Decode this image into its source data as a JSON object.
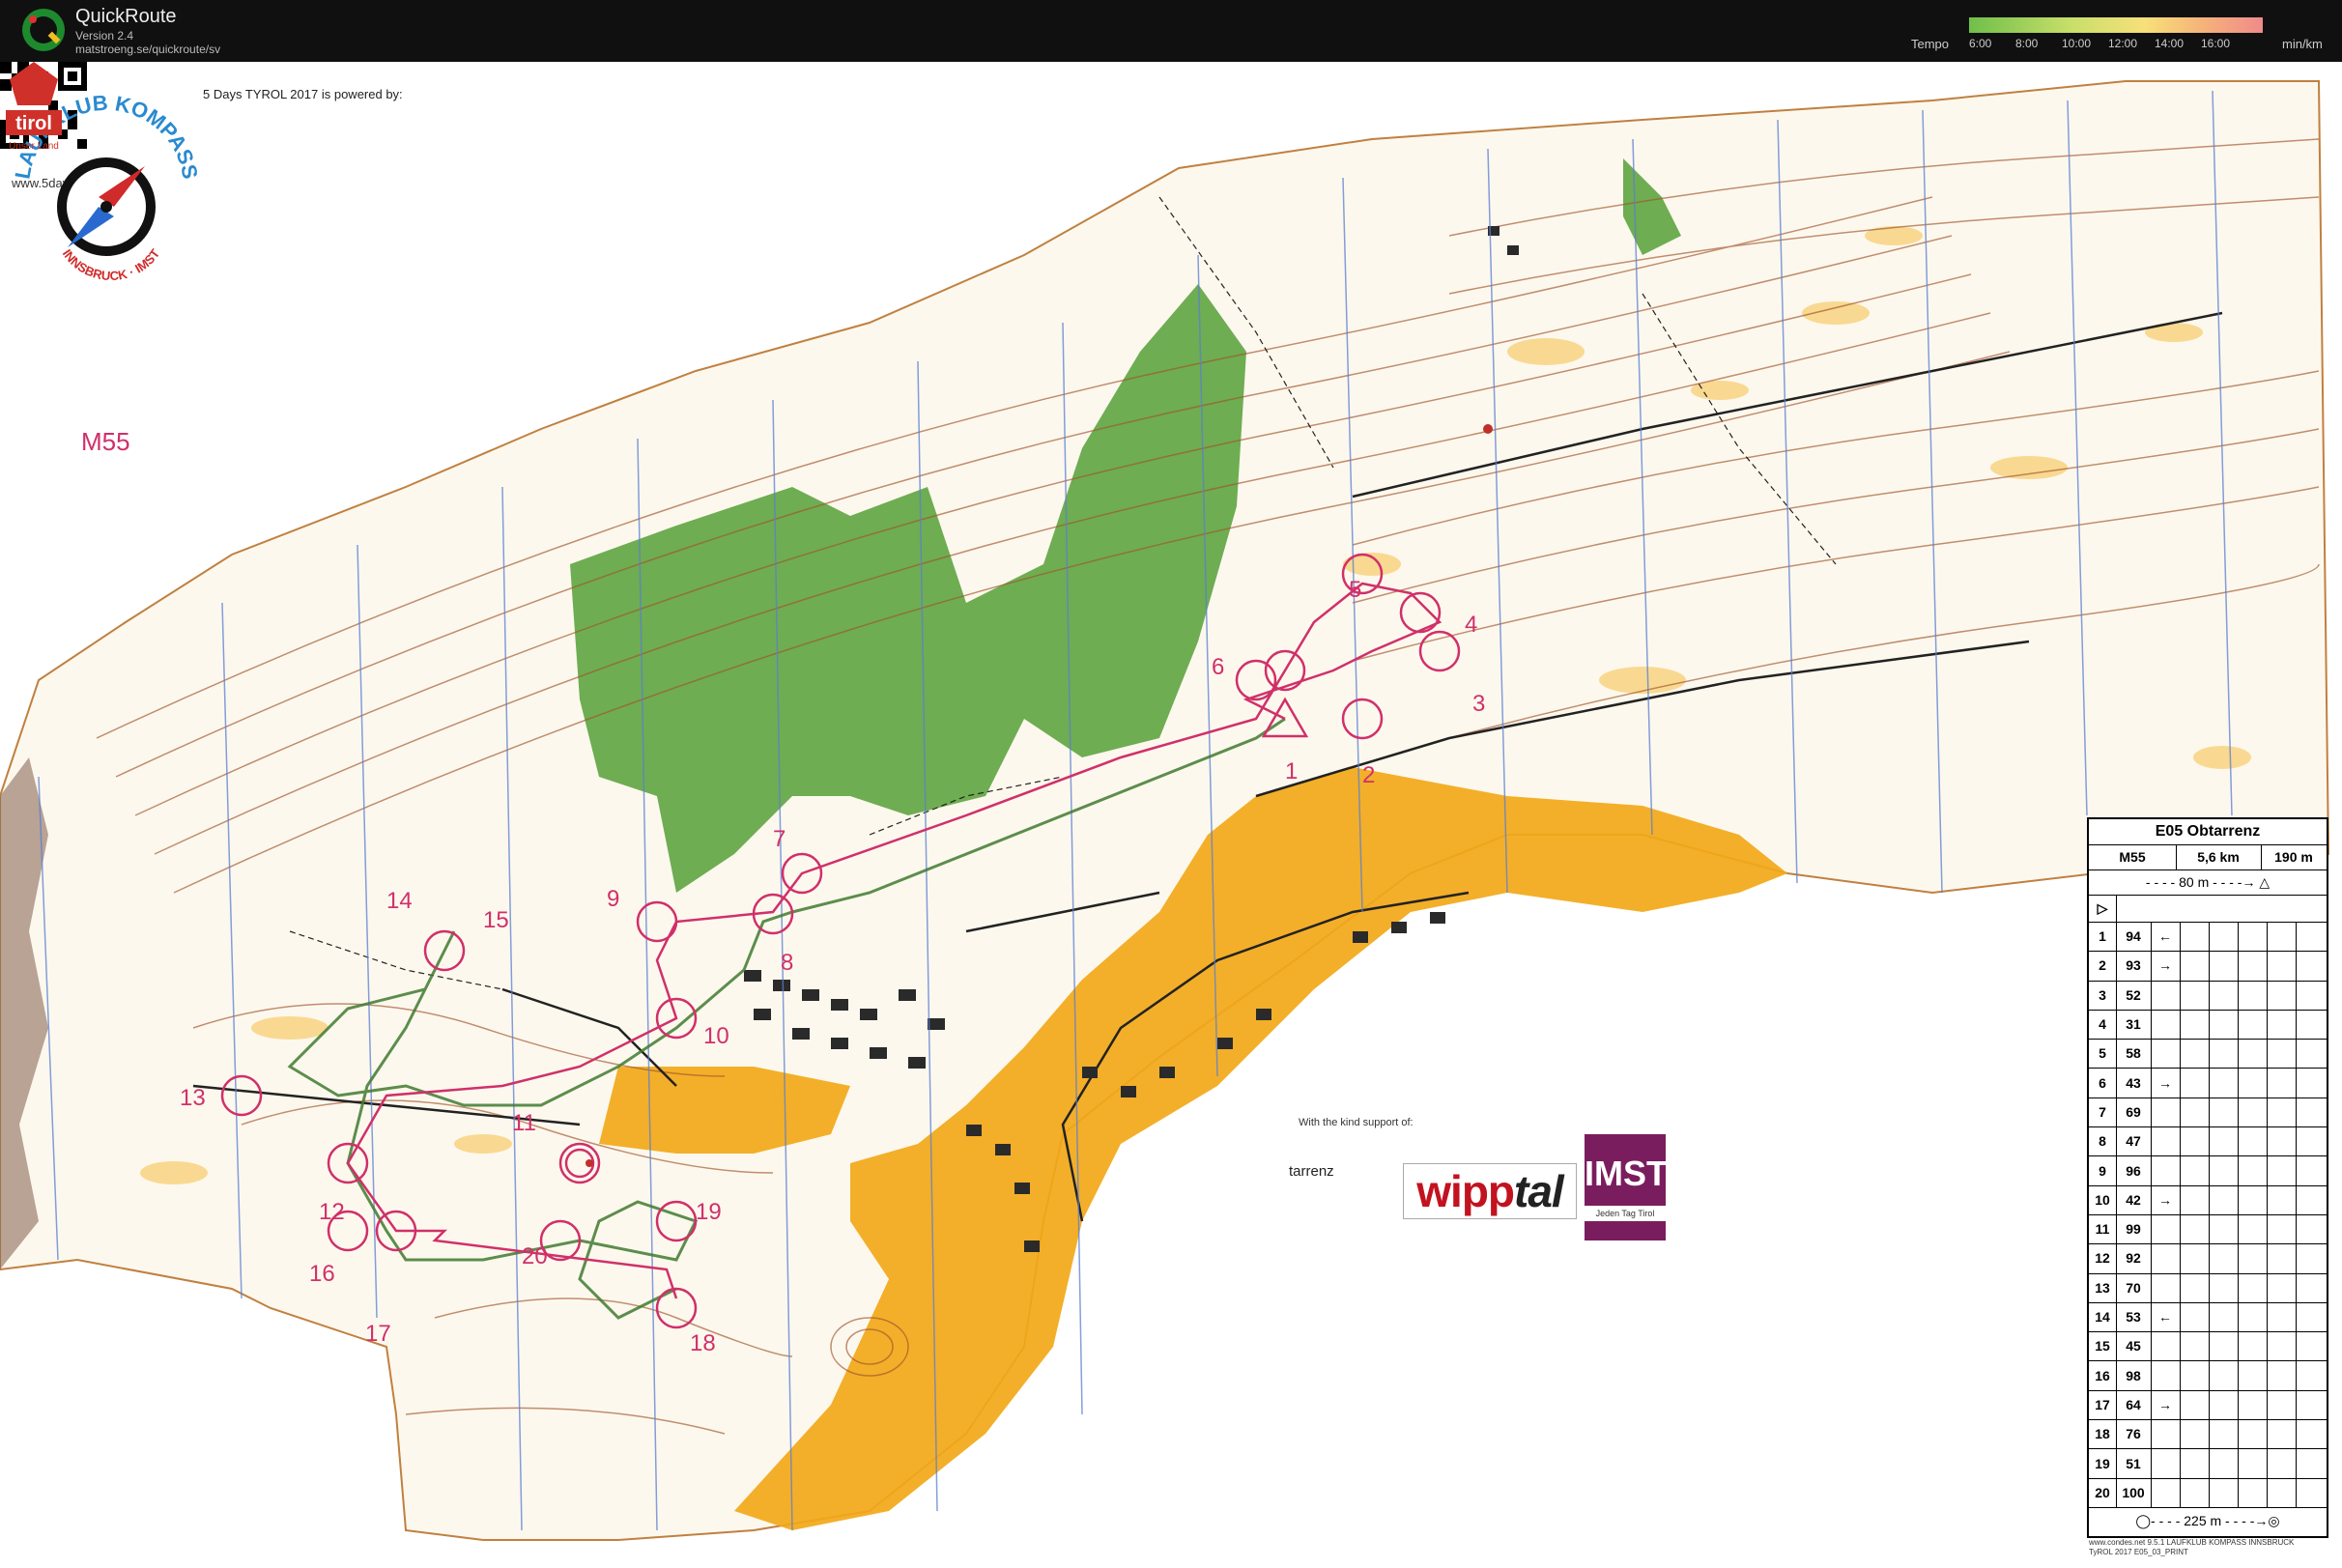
{
  "app": {
    "name": "QuickRoute",
    "version": "Version 2.4",
    "url": "matstroeng.se/quickroute/sv"
  },
  "tempo": {
    "label": "Tempo",
    "unit": "min/km",
    "ticks": [
      "6:00",
      "8:00",
      "10:00",
      "12:00",
      "14:00",
      "16:00"
    ]
  },
  "map": {
    "qr_url": "www.5days2017.tirol",
    "sponsor_text": "5 Days TYROL 2017 is powered by:",
    "club_name": "LAUFKLUB KOMPASS",
    "club_city": "INNSBRUCK · IMST",
    "category": "M55",
    "support_text": "With the kind support of:",
    "sponsors": {
      "tarrenz": "tarrenz",
      "wipp": "wipp",
      "tal": "tal",
      "imst": "IMST",
      "imst_tag": "Jeden Tag Tirol",
      "tirol": "tirol",
      "tirol_tag": "Unser Land"
    },
    "control_numbers": [
      "1",
      "2",
      "3",
      "4",
      "5",
      "6",
      "7",
      "8",
      "9",
      "10",
      "11",
      "12",
      "13",
      "14",
      "15",
      "16",
      "17",
      "18",
      "19",
      "20"
    ],
    "footer": [
      "www.condes.net 9.5.1 LAUFKLUB KOMPASS INNSBRUCK",
      "TyROL 2017 E05_03_PRINT"
    ]
  },
  "description": {
    "event": "E05 Obtarrenz",
    "class": "M55",
    "length": "5,6 km",
    "climb": "190 m",
    "to_start": "80 m",
    "to_finish": "225 m",
    "controls": [
      {
        "n": "1",
        "code": "94",
        "sym": "←"
      },
      {
        "n": "2",
        "code": "93",
        "sym": "→"
      },
      {
        "n": "3",
        "code": "52",
        "sym": ""
      },
      {
        "n": "4",
        "code": "31",
        "sym": ""
      },
      {
        "n": "5",
        "code": "58",
        "sym": ""
      },
      {
        "n": "6",
        "code": "43",
        "sym": "→"
      },
      {
        "n": "7",
        "code": "69",
        "sym": ""
      },
      {
        "n": "8",
        "code": "47",
        "sym": ""
      },
      {
        "n": "9",
        "code": "96",
        "sym": ""
      },
      {
        "n": "10",
        "code": "42",
        "sym": "→"
      },
      {
        "n": "11",
        "code": "99",
        "sym": ""
      },
      {
        "n": "12",
        "code": "92",
        "sym": ""
      },
      {
        "n": "13",
        "code": "70",
        "sym": ""
      },
      {
        "n": "14",
        "code": "53",
        "sym": "←"
      },
      {
        "n": "15",
        "code": "45",
        "sym": ""
      },
      {
        "n": "16",
        "code": "98",
        "sym": ""
      },
      {
        "n": "17",
        "code": "64",
        "sym": "→"
      },
      {
        "n": "18",
        "code": "76",
        "sym": ""
      },
      {
        "n": "19",
        "code": "51",
        "sym": ""
      },
      {
        "n": "20",
        "code": "100",
        "sym": ""
      }
    ]
  },
  "colors": {
    "course": "#d0306a",
    "forest": "#4a9a2a",
    "open": "#f2a818",
    "contour": "#a0552a",
    "magnetic": "#5a7fd0"
  }
}
